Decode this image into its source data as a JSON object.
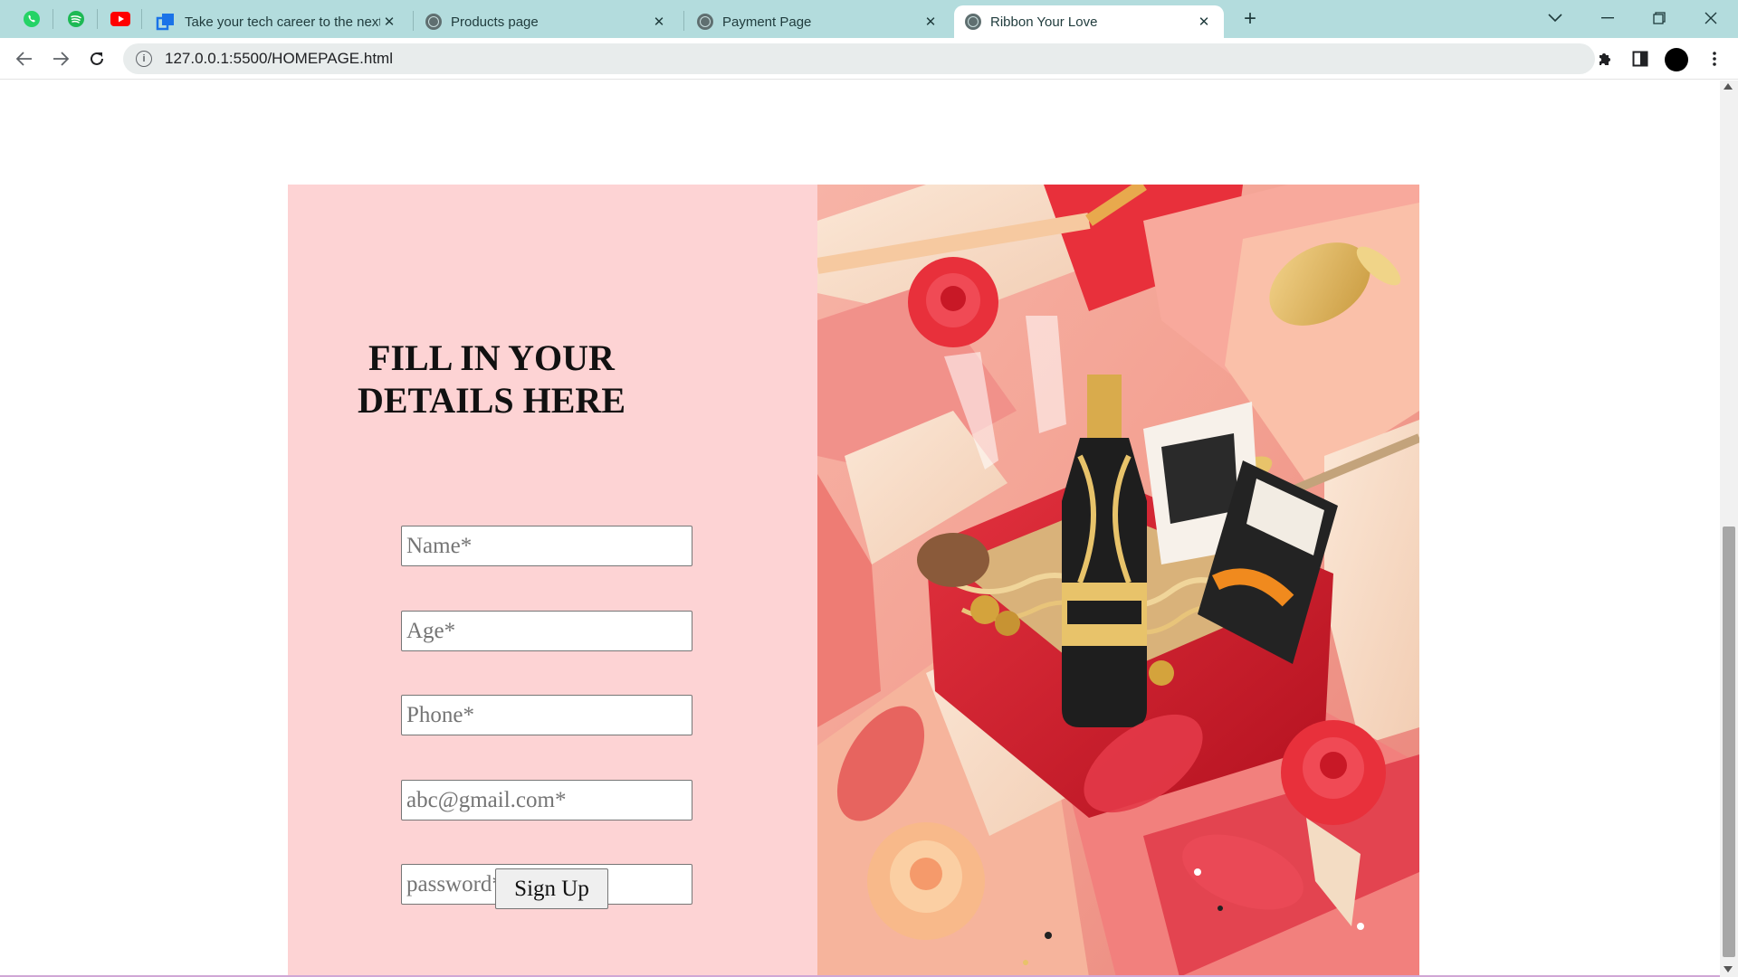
{
  "browser": {
    "tabs": [
      {
        "title": "Take your tech career to the next",
        "active": false
      },
      {
        "title": "Products page",
        "active": false
      },
      {
        "title": "Payment Page",
        "active": false
      },
      {
        "title": "Ribbon Your Love",
        "active": true
      }
    ],
    "url": "127.0.0.1:5500/HOMEPAGE.html",
    "pinned_icons": [
      "whatsapp-icon",
      "spotify-icon",
      "youtube-icon"
    ],
    "colors": {
      "tabbar": "#b3dcdd",
      "whatsapp": "#25d366",
      "spotify": "#1db954",
      "youtube": "#ff0000"
    }
  },
  "form": {
    "title": "FILL IN YOUR DETAILS HERE",
    "fields": [
      {
        "placeholder": "Name*"
      },
      {
        "placeholder": "Age*"
      },
      {
        "placeholder": "Phone*"
      },
      {
        "placeholder": "abc@gmail.com*"
      },
      {
        "placeholder": "password*"
      }
    ],
    "submit_label": "Sign Up",
    "panel_color": "#fdd3d4"
  }
}
